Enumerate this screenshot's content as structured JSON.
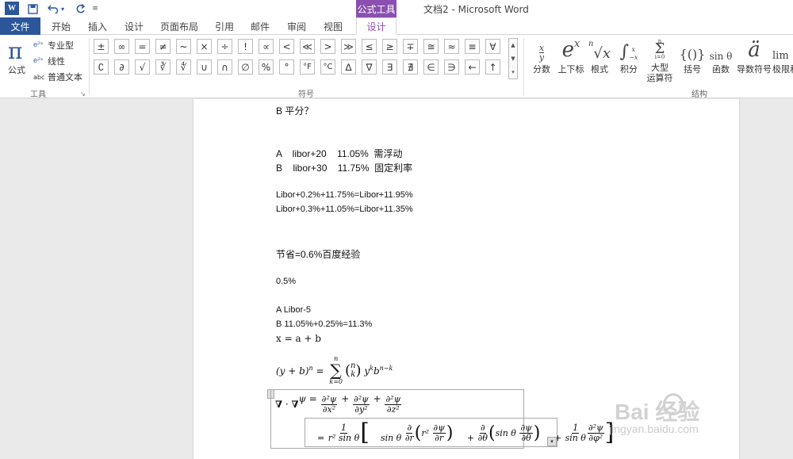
{
  "titlebar": {
    "logo": "W",
    "context_tab_group": "公式工具",
    "doc_title": "文档2 - Microsoft Word"
  },
  "tabs": [
    {
      "label": "文件"
    },
    {
      "label": "开始"
    },
    {
      "label": "插入"
    },
    {
      "label": "设计"
    },
    {
      "label": "页面布局"
    },
    {
      "label": "引用"
    },
    {
      "label": "邮件"
    },
    {
      "label": "审阅"
    },
    {
      "label": "视图"
    },
    {
      "label": "设计"
    }
  ],
  "tools_group": {
    "equation_label": "公式",
    "pi_glyph": "π",
    "professional": "专业型",
    "linear": "线性",
    "normal_text": "普通文本",
    "normal_text_icon": "abc",
    "group_label": "工具"
  },
  "symbols_group": {
    "row1": [
      "±",
      "∞",
      "=",
      "≠",
      "~",
      "×",
      "÷",
      "!",
      "∝",
      "<",
      "≪",
      ">",
      "≫",
      "≤",
      "≥",
      "∓",
      "≅",
      "≈",
      "≡",
      "∀"
    ],
    "row2": [
      "∁",
      "∂",
      "√",
      "∛",
      "∜",
      "∪",
      "∩",
      "∅",
      "%",
      "°",
      "°F",
      "°C",
      "∆",
      "∇",
      "∃",
      "∄",
      "∈",
      "∋",
      "←",
      "↑"
    ],
    "group_label": "符号"
  },
  "structures_group": {
    "items": [
      {
        "glyph": "x/y",
        "label": "分数"
      },
      {
        "glyph": "eˣ",
        "label": "上下标"
      },
      {
        "glyph": "ⁿ√x",
        "label": "根式"
      },
      {
        "glyph": "∫",
        "label": "积分"
      },
      {
        "glyph": "Σ",
        "label": "大型\n运算符"
      },
      {
        "glyph": "{()}",
        "label": "括号"
      },
      {
        "glyph": "sin θ",
        "label": "函数"
      },
      {
        "glyph": "ä",
        "label": "导数符号"
      },
      {
        "glyph": "lim",
        "label": "极限和"
      }
    ],
    "group_label": "结构"
  },
  "document": {
    "lines": [
      "B 平分？",
      "A    libor+20    11.05%  需浮动",
      "B    libor+30    11.75%  固定利率",
      "Libor+0.2%+11.75%=Libor+11.95%",
      "Libor+0.3%+11.05%=Libor+11.35%",
      "节省=0.6%百度经验",
      "0.5%",
      "A Libor-5",
      "B 11.05%+0.25%=11.3%",
      "x = a + b"
    ],
    "binomial_equation": "(y + b)ⁿ = Σ (n k) yᵏbⁿ⁻ᵏ",
    "laplacian_equation": "∇ · ∇ψ = ∂²ψ/∂x² + ∂²ψ/∂y² + ∂²ψ/∂z²"
  },
  "watermark": {
    "brand": "Bai  经验",
    "url": "jingyan.baidu.com"
  },
  "colors": {
    "word_blue": "#2b579a",
    "context_purple": "#8a4fb0"
  }
}
